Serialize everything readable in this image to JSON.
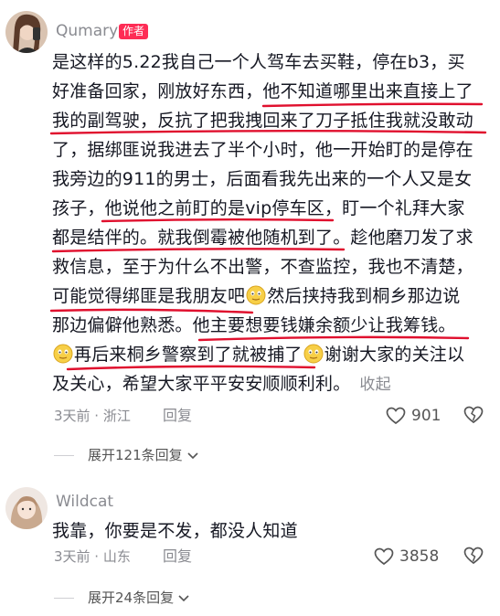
{
  "comments": [
    {
      "username": "Qumary",
      "badge": "作者",
      "lines": [
        "是这样的5.22我自己一个人驾车去买鞋，停在b3，买",
        "好准备回家，刚放好东西，他不知道哪里出来直接上了",
        "我的副驾驶，反抗了把我拽回来了刀子抵住我就没敢动",
        "了，据绑匪说我进去了半个小时，他一开始盯的是停在",
        "我旁边的911的男士，后面看我先出来的一个人又是女",
        "孩子，他说他之前盯的是vip停车区，盯一个礼拜大家",
        "都是结伴的。就我倒霉被他随机到了。趁他磨刀发了求",
        "救信息，至于为什么不出警，不查监控，我也不清楚，"
      ],
      "line9a": "可能觉得绑匪是我朋友吧",
      "line9b": "然后挟持我到桐乡那边说",
      "line10": "那边偏僻他熟悉。他主要想要钱嫌余额少让我筹钱。",
      "line11a": "再后来桐乡警察到了就被捕了",
      "line11b": "谢谢大家的关注以",
      "line12": "及关心，希望大家平平安安顺顺利利。",
      "collapse": "收起",
      "time_location": "3天前 · 浙江",
      "reply": "回复",
      "likes": "901",
      "expand": "展开121条回复"
    },
    {
      "username": "Wildcat",
      "text": "我靠，你要是不发，都没人知道",
      "time_location": "3天前 · 山东",
      "reply": "回复",
      "likes": "3858",
      "expand": "展开24条回复"
    }
  ],
  "colors": {
    "accent": "#fe2c55",
    "underline": "#e0102e",
    "meta": "#8a8b91"
  },
  "icons": [
    "heart-icon",
    "broken-heart-icon",
    "chevron-down-icon",
    "smile-emoji-icon"
  ]
}
